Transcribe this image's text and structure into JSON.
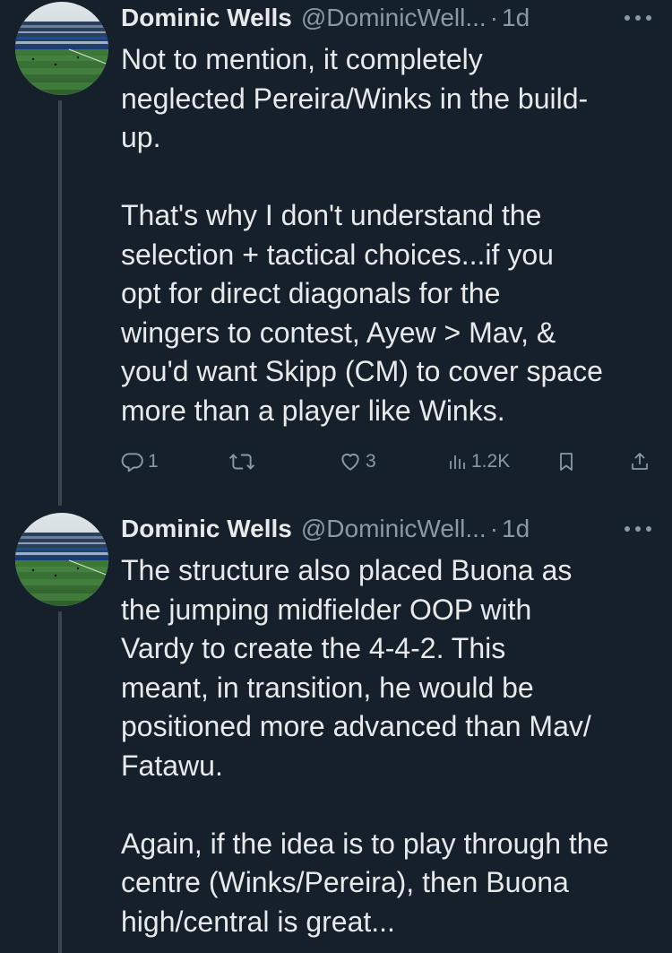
{
  "tweets": [
    {
      "author": {
        "name": "Dominic Wells",
        "handle": "@DominicWell...",
        "avatar_icon": "stadium-crowd-photo"
      },
      "separator": "·",
      "time": "1d",
      "text": "Not to mention, it completely\nneglected Pereira/Winks in the build-\nup.\n\nThat's why I don't understand the\nselection + tactical choices...if you\nopt for direct diagonals for the\nwingers to contest, Ayew > Mav, &\nyou'd want Skipp (CM) to cover space\nmore than a player like Winks.",
      "stats": {
        "replies": "1",
        "retweets": "",
        "likes": "3",
        "views": "1.2K"
      }
    },
    {
      "author": {
        "name": "Dominic Wells",
        "handle": "@DominicWell...",
        "avatar_icon": "stadium-crowd-photo"
      },
      "separator": "·",
      "time": "1d",
      "text": "The structure also placed Buona as\nthe jumping midfielder OOP with\nVardy to create the 4-4-2. This\nmeant, in transition, he would be\npositioned more advanced than Mav/\nFatawu.\n\nAgain, if the idea is to play through the\ncentre (Winks/Pereira), then Buona\nhigh/central is great..."
    }
  ],
  "colors": {
    "background": "#15202b",
    "text_primary": "#e7e9ea",
    "text_secondary": "#8b98a5",
    "thread_line": "#3a444c"
  }
}
